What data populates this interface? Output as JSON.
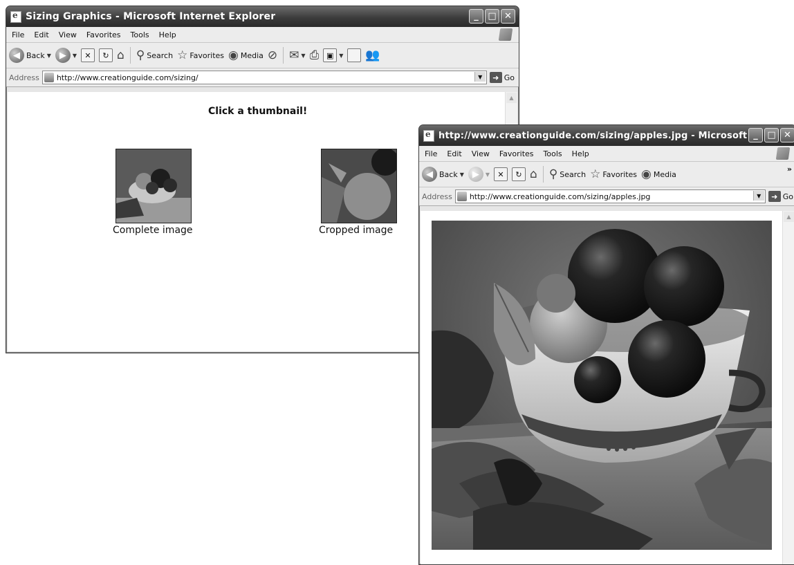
{
  "window_main": {
    "title": "Sizing Graphics - Microsoft Internet Explorer",
    "menu": [
      "File",
      "Edit",
      "View",
      "Favorites",
      "Tools",
      "Help"
    ],
    "toolbar": {
      "back": "Back",
      "search": "Search",
      "favorites": "Favorites",
      "media": "Media"
    },
    "address": {
      "label": "Address",
      "url": "http://www.creationguide.com/sizing/",
      "go": "Go"
    },
    "page": {
      "heading": "Click a thumbnail!",
      "thumbnails": [
        {
          "caption": "Complete image"
        },
        {
          "caption": "Cropped image"
        }
      ]
    }
  },
  "window_popup": {
    "title": "http://www.creationguide.com/sizing/apples.jpg - Microsoft Int...",
    "menu": [
      "File",
      "Edit",
      "View",
      "Favorites",
      "Tools",
      "Help"
    ],
    "toolbar": {
      "back": "Back",
      "search": "Search",
      "favorites": "Favorites",
      "media": "Media",
      "overflow": "»"
    },
    "address": {
      "label": "Address",
      "url": "http://www.creationguide.com/sizing/apples.jpg",
      "go": "Go"
    }
  },
  "icons": {
    "minimize": "minimize-icon",
    "maximize": "maximize-icon",
    "close": "close-icon",
    "back": "back-arrow-icon",
    "forward": "forward-arrow-icon",
    "stop": "stop-icon",
    "refresh": "refresh-icon",
    "home": "home-icon",
    "search": "search-icon",
    "favorites": "star-icon",
    "media": "media-icon",
    "history": "history-icon",
    "mail": "mail-icon",
    "print": "print-icon",
    "edit": "edit-icon",
    "discuss": "discuss-icon",
    "messenger": "messenger-icon",
    "windows_logo": "windows-logo-icon",
    "page": "page-icon",
    "go": "go-arrow-icon"
  }
}
